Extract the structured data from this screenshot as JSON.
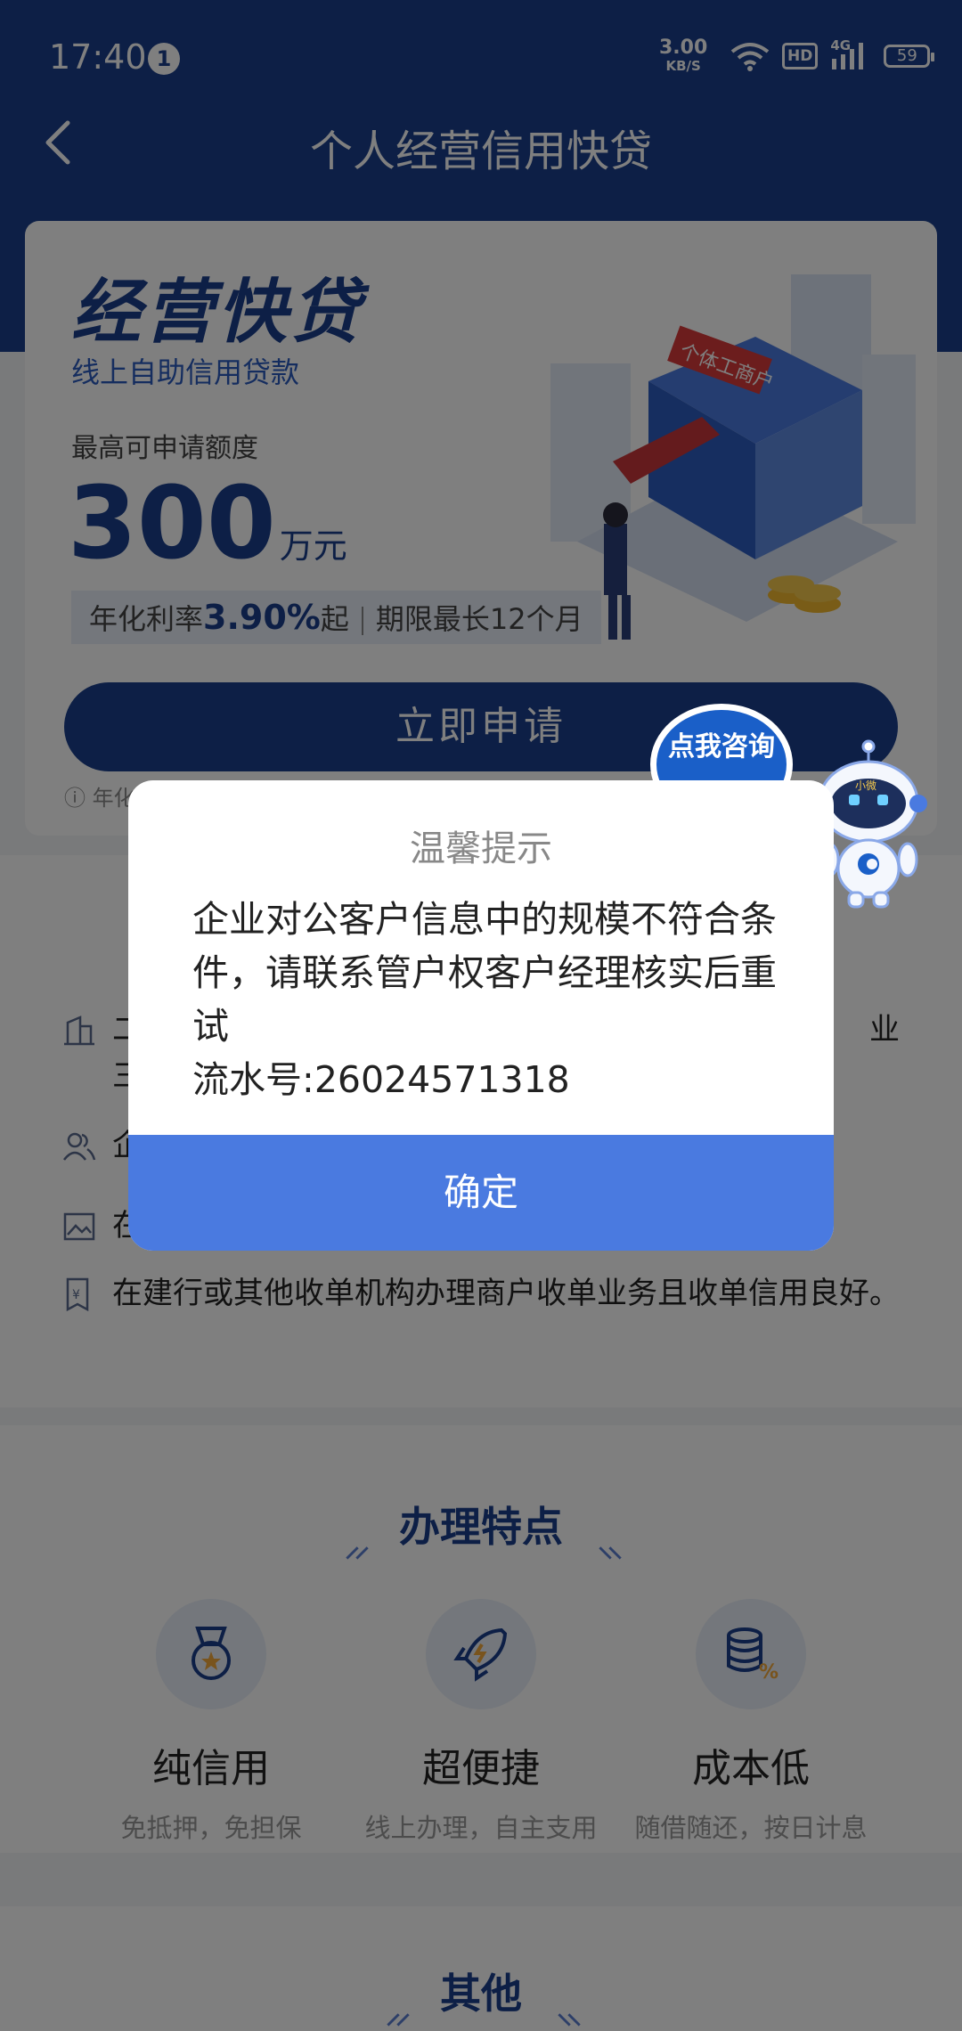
{
  "status_bar": {
    "time": "17:40",
    "notification_count": "1",
    "net_speed_value": "3.00",
    "net_speed_unit": "KB/S",
    "hd_label": "HD",
    "network_type": "4G",
    "battery_level": "59"
  },
  "nav": {
    "title": "个人经营信用快贷"
  },
  "hero": {
    "title": "经营快贷",
    "subtitle": "线上自助信用贷款",
    "limit_label": "最高可申请额度",
    "amount": "300",
    "amount_unit": "万元",
    "rate_prefix": "年化利率",
    "rate_value": "3.90%",
    "rate_suffix": "起",
    "term": "期限最长12个月",
    "apply_label": "立即申请",
    "note_prefix": "年化",
    "illustration_sign": "个体工商户"
  },
  "conditions": {
    "item1_start": "二",
    "item1_line2": "三",
    "item1_end": "业",
    "item2_start": "企",
    "item3_start": "在",
    "item4": "在建行或其他收单机构办理商户收单业务且收单信用良好。"
  },
  "features": {
    "section_title": "办理特点",
    "items": [
      {
        "name": "纯信用",
        "desc": "免抵押，免担保",
        "icon": "medal-icon"
      },
      {
        "name": "超便捷",
        "desc": "线上办理，自主支用",
        "icon": "rocket-icon"
      },
      {
        "name": "成本低",
        "desc": "随借随还，按日计息",
        "icon": "coins-percent-icon"
      }
    ]
  },
  "other": {
    "section_title": "其他"
  },
  "dialog": {
    "title": "温馨提示",
    "message": "企业对公客户信息中的规模不符合条件，请联系管户权客户经理核实后重试",
    "serial": "流水号:26024571318",
    "confirm_label": "确定"
  },
  "consult": {
    "bubble_text": "点我咨询",
    "robot_badge": "小微"
  },
  "colors": {
    "brand_dark": "#1a3f8c",
    "dialog_button": "#4a7ae0",
    "bubble": "#1a5fc8"
  }
}
